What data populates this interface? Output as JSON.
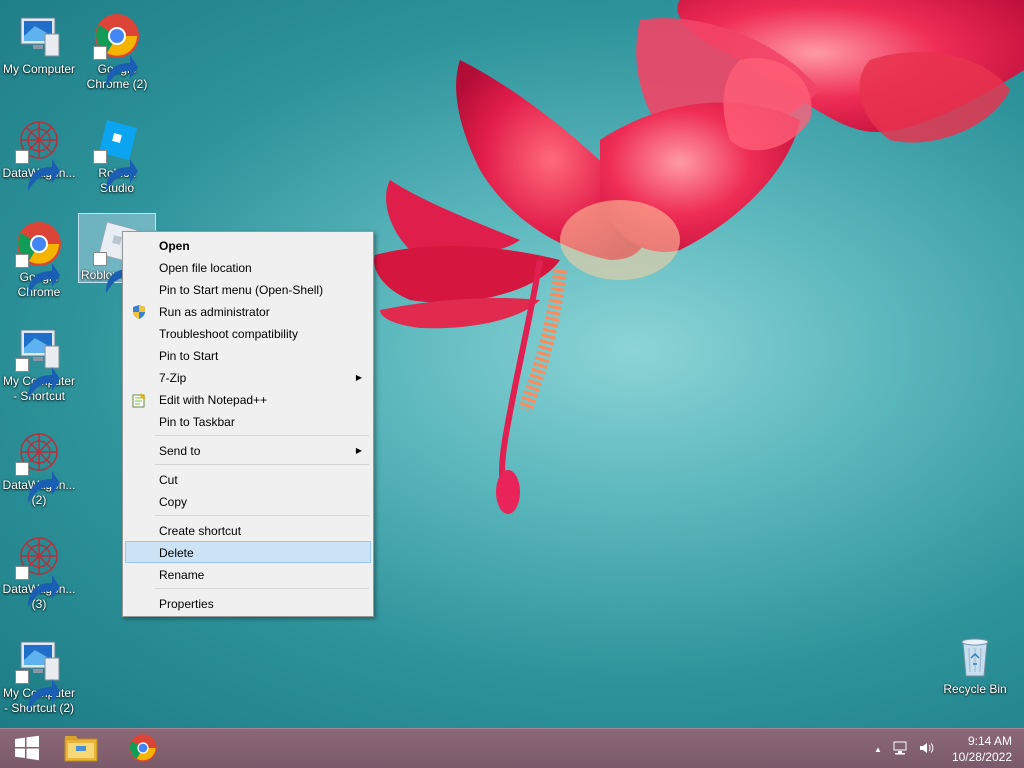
{
  "desktop": {
    "icons": [
      {
        "label": "My Computer",
        "icon": "computer-icon"
      },
      {
        "label": "Google Chrome (2)",
        "icon": "chrome-icon"
      },
      {
        "label": "DataWagon...",
        "icon": "datawagon-icon"
      },
      {
        "label": "Roblox Studio",
        "icon": "roblox-studio-icon"
      },
      {
        "label": "Google Chrome",
        "icon": "chrome-icon"
      },
      {
        "label": "Roblox I",
        "icon": "roblox-icon"
      },
      {
        "label": "My Computer - Shortcut",
        "icon": "computer-icon"
      },
      {
        "label": "DataWagon... (2)",
        "icon": "datawagon-icon"
      },
      {
        "label": "DataWagon... (3)",
        "icon": "datawagon-icon"
      },
      {
        "label": "My Computer - Shortcut (2)",
        "icon": "computer-icon"
      },
      {
        "label": "Recycle Bin",
        "icon": "recycle-bin-icon"
      }
    ]
  },
  "context_menu": {
    "items": [
      {
        "label": "Open"
      },
      {
        "label": "Open file location"
      },
      {
        "label": "Pin to Start menu (Open-Shell)"
      },
      {
        "label": "Run as administrator",
        "icon": "uac-shield-icon"
      },
      {
        "label": "Troubleshoot compatibility"
      },
      {
        "label": "Pin to Start"
      },
      {
        "label": "7-Zip",
        "submenu": true
      },
      {
        "label": "Edit with Notepad++",
        "icon": "notepad-plus-plus-icon"
      },
      {
        "label": "Pin to Taskbar"
      },
      {
        "label": "Send to",
        "submenu": true
      },
      {
        "label": "Cut"
      },
      {
        "label": "Copy"
      },
      {
        "label": "Create shortcut"
      },
      {
        "label": "Delete",
        "highlighted": true
      },
      {
        "label": "Rename"
      },
      {
        "label": "Properties"
      }
    ],
    "submenu_glyph": "▶"
  },
  "taskbar": {
    "start_icon": "windows-logo-icon",
    "pinned": [
      "file-explorer-icon",
      "chrome-icon"
    ],
    "tray_arrow": "▲",
    "time": "9:14 AM",
    "date": "10/28/2022"
  },
  "colors": {
    "menu_highlight": "#cce3f5",
    "menu_highlight_border": "#99c9ef",
    "taskbar": "#7a5a6a"
  }
}
